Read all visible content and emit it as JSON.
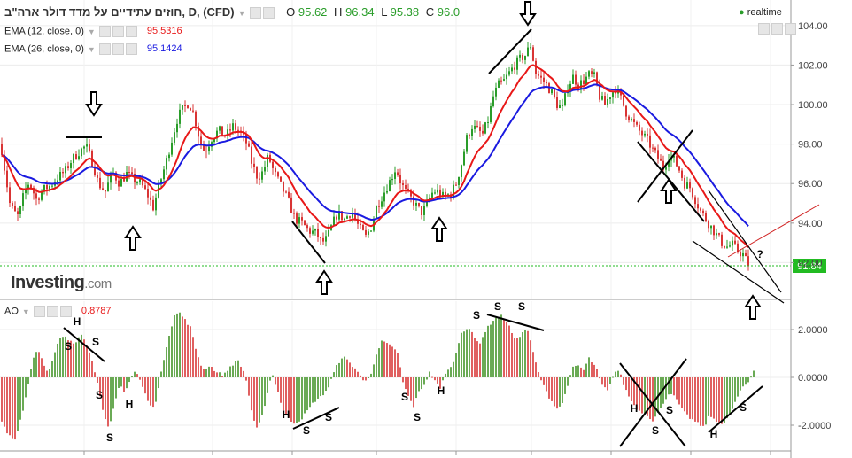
{
  "header": {
    "symbol": "חוזים עתידיים על מדד דולר ארה\"ב, D, (CFD)",
    "o_label": "O",
    "o": "95.62",
    "h_label": "H",
    "h": "96.34",
    "l_label": "L",
    "l": "95.38",
    "c_label": "C",
    "c": "96.0",
    "realtime": "realtime"
  },
  "indicators": {
    "ema12_label": "EMA (12, close, 0)",
    "ema12_value": "95.5316",
    "ema26_label": "EMA (26, close, 0)",
    "ema26_value": "95.1424",
    "ao_label": "AO",
    "ao_value": "0.8787"
  },
  "logo": {
    "brand": "Investing",
    "suffix": ".com"
  },
  "colors": {
    "up": "#2a9d2a",
    "down": "#d93434",
    "ema12": "#e81818",
    "ema26": "#1a1ae0",
    "ao_up": "#6aaa55",
    "ao_down": "#e06060",
    "price_tag": "#22bb22"
  },
  "chart_data": [
    {
      "type": "candlestick",
      "title": "",
      "y_ticks": [
        "104.00",
        "102.00",
        "100.00",
        "98.00",
        "96.00",
        "94.00",
        "92.00"
      ],
      "ylim": [
        90.7,
        105.4
      ],
      "current_price": "91.84",
      "series": [
        {
          "name": "EMA (12, close, 0)"
        },
        {
          "name": "EMA (26, close, 0)"
        }
      ],
      "close_trace": [
        [
          0,
          98.0
        ],
        [
          6,
          96.2
        ],
        [
          10,
          95.0
        ],
        [
          14,
          94.6
        ],
        [
          20,
          94.3
        ],
        [
          26,
          95.5
        ],
        [
          32,
          96.1
        ],
        [
          40,
          95.2
        ],
        [
          48,
          95.7
        ],
        [
          56,
          95.9
        ],
        [
          64,
          96.3
        ],
        [
          72,
          96.6
        ],
        [
          80,
          97.2
        ],
        [
          88,
          97.6
        ],
        [
          96,
          97.9
        ],
        [
          104,
          97.0
        ],
        [
          110,
          96.0
        ],
        [
          118,
          95.6
        ],
        [
          126,
          96.6
        ],
        [
          134,
          96.0
        ],
        [
          142,
          96.5
        ],
        [
          150,
          96.2
        ],
        [
          158,
          96.0
        ],
        [
          166,
          95.4
        ],
        [
          172,
          94.8
        ],
        [
          178,
          95.8
        ],
        [
          186,
          97.0
        ],
        [
          194,
          98.4
        ],
        [
          200,
          99.4
        ],
        [
          206,
          99.8
        ],
        [
          212,
          100.1
        ],
        [
          218,
          99.5
        ],
        [
          224,
          98.3
        ],
        [
          230,
          97.6
        ],
        [
          238,
          98.3
        ],
        [
          246,
          98.7
        ],
        [
          254,
          98.4
        ],
        [
          262,
          98.9
        ],
        [
          270,
          98.6
        ],
        [
          278,
          98.0
        ],
        [
          284,
          96.9
        ],
        [
          290,
          96.3
        ],
        [
          296,
          96.6
        ],
        [
          302,
          97.4
        ],
        [
          308,
          96.6
        ],
        [
          316,
          95.9
        ],
        [
          324,
          95.2
        ],
        [
          332,
          94.2
        ],
        [
          340,
          94.0
        ],
        [
          348,
          93.6
        ],
        [
          356,
          93.5
        ],
        [
          362,
          93.0
        ],
        [
          368,
          93.2
        ],
        [
          374,
          93.9
        ],
        [
          380,
          94.5
        ],
        [
          388,
          94.2
        ],
        [
          396,
          94.6
        ],
        [
          404,
          93.8
        ],
        [
          412,
          93.3
        ],
        [
          418,
          93.8
        ],
        [
          424,
          94.8
        ],
        [
          432,
          95.5
        ],
        [
          440,
          96.2
        ],
        [
          446,
          96.8
        ],
        [
          452,
          96.0
        ],
        [
          458,
          95.5
        ],
        [
          464,
          95.2
        ],
        [
          470,
          94.8
        ],
        [
          476,
          94.5
        ],
        [
          482,
          95.1
        ],
        [
          488,
          95.6
        ],
        [
          494,
          95.6
        ],
        [
          500,
          95.3
        ],
        [
          508,
          95.5
        ],
        [
          514,
          96.0
        ],
        [
          520,
          97.0
        ],
        [
          526,
          98.3
        ],
        [
          532,
          98.9
        ],
        [
          538,
          98.7
        ],
        [
          544,
          98.5
        ],
        [
          550,
          99.2
        ],
        [
          556,
          100.4
        ],
        [
          562,
          101.0
        ],
        [
          568,
          101.2
        ],
        [
          574,
          101.6
        ],
        [
          580,
          102.0
        ],
        [
          586,
          102.3
        ],
        [
          592,
          102.5
        ],
        [
          598,
          103.0
        ],
        [
          604,
          101.6
        ],
        [
          610,
          101.3
        ],
        [
          616,
          101.0
        ],
        [
          622,
          100.6
        ],
        [
          628,
          100.0
        ],
        [
          634,
          99.8
        ],
        [
          640,
          100.9
        ],
        [
          646,
          101.4
        ],
        [
          652,
          101.0
        ],
        [
          658,
          101.2
        ],
        [
          664,
          101.5
        ],
        [
          670,
          101.4
        ],
        [
          676,
          100.4
        ],
        [
          682,
          100.0
        ],
        [
          688,
          100.5
        ],
        [
          694,
          100.8
        ],
        [
          700,
          100.3
        ],
        [
          706,
          99.6
        ],
        [
          712,
          99.2
        ],
        [
          718,
          98.8
        ],
        [
          724,
          98.5
        ],
        [
          730,
          98.2
        ],
        [
          736,
          97.7
        ],
        [
          742,
          97.3
        ],
        [
          748,
          96.8
        ],
        [
          754,
          97.4
        ],
        [
          760,
          97.2
        ],
        [
          766,
          96.7
        ],
        [
          772,
          96.0
        ],
        [
          778,
          95.8
        ],
        [
          784,
          95.2
        ],
        [
          790,
          94.6
        ],
        [
          796,
          94.2
        ],
        [
          802,
          93.8
        ],
        [
          808,
          93.4
        ],
        [
          814,
          93.0
        ],
        [
          820,
          92.8
        ],
        [
          826,
          92.9
        ],
        [
          832,
          92.6
        ],
        [
          838,
          92.4
        ],
        [
          844,
          91.9
        ]
      ]
    },
    {
      "type": "bar",
      "title": "",
      "name": "AO",
      "y_ticks": [
        "2.0000",
        "0.0000",
        "-2.0000"
      ],
      "ylim": [
        -3.0,
        2.85
      ],
      "trace": [
        [
          0,
          -1.8
        ],
        [
          8,
          -2.4
        ],
        [
          16,
          -2.6
        ],
        [
          24,
          -1.5
        ],
        [
          30,
          -0.5
        ],
        [
          36,
          0.8
        ],
        [
          42,
          1.2
        ],
        [
          48,
          0.6
        ],
        [
          54,
          0.2
        ],
        [
          60,
          0.9
        ],
        [
          66,
          1.6
        ],
        [
          72,
          1.7
        ],
        [
          78,
          1.5
        ],
        [
          84,
          1.4
        ],
        [
          90,
          1.9
        ],
        [
          96,
          1.5
        ],
        [
          102,
          0.8
        ],
        [
          110,
          -0.3
        ],
        [
          116,
          -1.6
        ],
        [
          122,
          -2.2
        ],
        [
          128,
          -1.2
        ],
        [
          134,
          -0.3
        ],
        [
          140,
          -0.6
        ],
        [
          146,
          -0.1
        ],
        [
          152,
          0.3
        ],
        [
          158,
          -0.2
        ],
        [
          164,
          -0.8
        ],
        [
          170,
          -1.3
        ],
        [
          176,
          -0.9
        ],
        [
          182,
          0.4
        ],
        [
          188,
          1.5
        ],
        [
          196,
          2.6
        ],
        [
          202,
          2.7
        ],
        [
          208,
          2.4
        ],
        [
          214,
          2.1
        ],
        [
          220,
          1.2
        ],
        [
          228,
          0.3
        ],
        [
          236,
          0.5
        ],
        [
          244,
          0.2
        ],
        [
          252,
          0.1
        ],
        [
          260,
          0.5
        ],
        [
          268,
          0.7
        ],
        [
          276,
          0.1
        ],
        [
          282,
          -1.2
        ],
        [
          288,
          -2.2
        ],
        [
          294,
          -1.8
        ],
        [
          300,
          -0.8
        ],
        [
          306,
          0.2
        ],
        [
          312,
          -0.5
        ],
        [
          318,
          -1.3
        ],
        [
          324,
          -1.7
        ],
        [
          330,
          -1.9
        ],
        [
          338,
          -1.8
        ],
        [
          346,
          -1.4
        ],
        [
          354,
          -1.0
        ],
        [
          362,
          -0.8
        ],
        [
          370,
          -0.4
        ],
        [
          378,
          0.4
        ],
        [
          386,
          0.9
        ],
        [
          394,
          0.6
        ],
        [
          402,
          0.3
        ],
        [
          410,
          -0.2
        ],
        [
          418,
          0.2
        ],
        [
          424,
          0.9
        ],
        [
          430,
          1.5
        ],
        [
          436,
          1.4
        ],
        [
          442,
          1.3
        ],
        [
          448,
          1.0
        ],
        [
          454,
          -0.2
        ],
        [
          460,
          -0.8
        ],
        [
          466,
          -1.2
        ],
        [
          472,
          -0.6
        ],
        [
          478,
          -0.3
        ],
        [
          484,
          0.2
        ],
        [
          490,
          -0.1
        ],
        [
          496,
          -0.5
        ],
        [
          502,
          0.2
        ],
        [
          508,
          0.4
        ],
        [
          514,
          1.0
        ],
        [
          520,
          1.9
        ],
        [
          528,
          2.1
        ],
        [
          534,
          1.7
        ],
        [
          540,
          1.4
        ],
        [
          548,
          2.0
        ],
        [
          556,
          2.4
        ],
        [
          564,
          2.6
        ],
        [
          572,
          2.3
        ],
        [
          580,
          1.6
        ],
        [
          588,
          1.8
        ],
        [
          594,
          2.1
        ],
        [
          600,
          1.2
        ],
        [
          606,
          0.3
        ],
        [
          612,
          -0.3
        ],
        [
          620,
          -0.9
        ],
        [
          628,
          -1.3
        ],
        [
          634,
          -1.1
        ],
        [
          640,
          -0.3
        ],
        [
          646,
          0.4
        ],
        [
          652,
          0.5
        ],
        [
          658,
          0.3
        ],
        [
          664,
          0.8
        ],
        [
          672,
          0.4
        ],
        [
          678,
          -0.3
        ],
        [
          686,
          -0.6
        ],
        [
          692,
          0.2
        ],
        [
          698,
          0.3
        ],
        [
          704,
          -0.4
        ],
        [
          712,
          -1.0
        ],
        [
          720,
          -1.4
        ],
        [
          728,
          -1.5
        ],
        [
          736,
          -1.8
        ],
        [
          744,
          -1.4
        ],
        [
          750,
          -0.9
        ],
        [
          756,
          -0.6
        ],
        [
          764,
          -1.0
        ],
        [
          770,
          -1.4
        ],
        [
          778,
          -1.7
        ],
        [
          786,
          -1.9
        ],
        [
          794,
          -2.1
        ],
        [
          800,
          -1.6
        ],
        [
          808,
          -1.8
        ],
        [
          816,
          -2.0
        ],
        [
          824,
          -1.5
        ],
        [
          832,
          -0.8
        ],
        [
          838,
          -0.4
        ],
        [
          844,
          -0.2
        ],
        [
          850,
          0.3
        ]
      ]
    }
  ],
  "annotations": {
    "labels": [
      "H",
      "S",
      "S",
      "S",
      "H",
      "S",
      "H",
      "S",
      "S",
      "S",
      "S",
      "H",
      "S",
      "S",
      "S",
      "H",
      "S",
      "S",
      "H",
      "S",
      "?"
    ]
  }
}
